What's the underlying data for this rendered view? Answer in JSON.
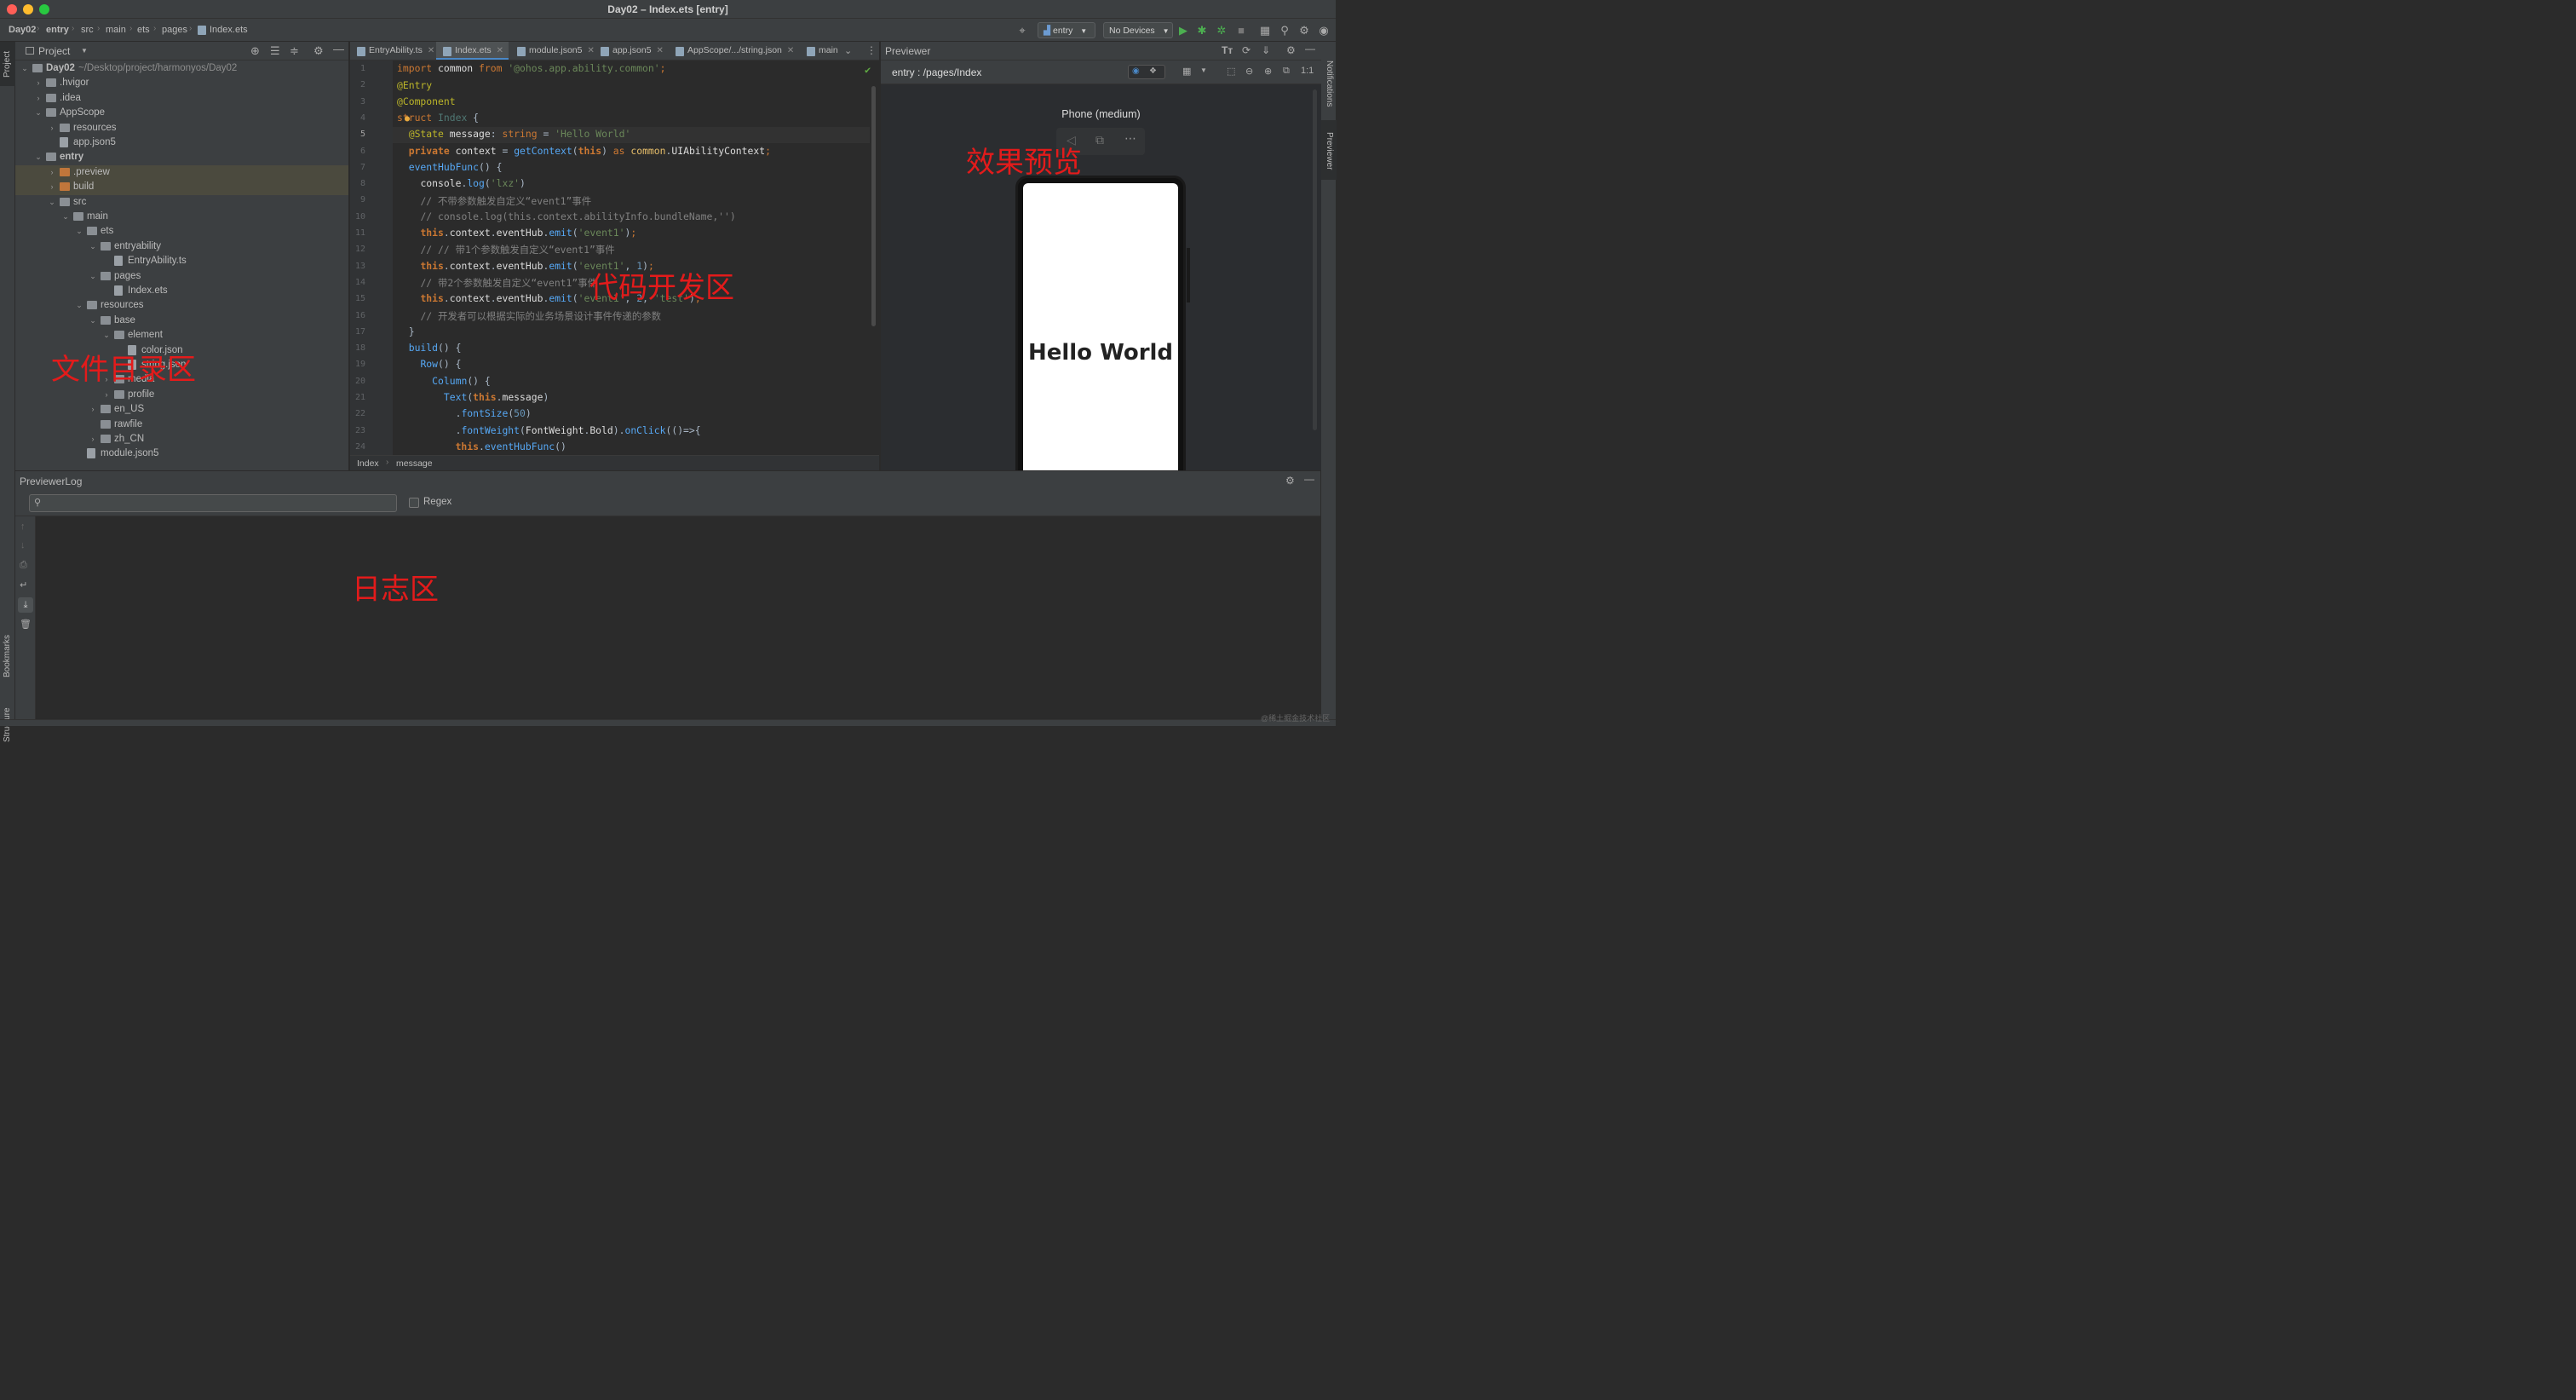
{
  "window": {
    "title": "Day02 – Index.ets [entry]",
    "traffic_colors": [
      "#ff5f57",
      "#febc2e",
      "#28c840"
    ]
  },
  "navbar": {
    "breadcrumb": [
      "Day02",
      "entry",
      "src",
      "main",
      "ets",
      "pages",
      "Index.ets"
    ],
    "module_select": "entry",
    "device_select": "No Devices"
  },
  "left_strip": {
    "project": "Project",
    "bookmarks": "Bookmarks",
    "structure": "Structure"
  },
  "right_strip": {
    "notifications": "Notifications",
    "previewer": "Previewer"
  },
  "project_panel": {
    "title": "Project",
    "tree": [
      {
        "label": "Day02",
        "suffix": "~/Desktop/project/harmonyos/Day02",
        "depth": 0,
        "arrow": "open",
        "type": "folder",
        "bold": true
      },
      {
        "label": ".hvigor",
        "depth": 1,
        "arrow": "closed",
        "type": "folder"
      },
      {
        "label": ".idea",
        "depth": 1,
        "arrow": "closed",
        "type": "folder"
      },
      {
        "label": "AppScope",
        "depth": 1,
        "arrow": "open",
        "type": "folder"
      },
      {
        "label": "resources",
        "depth": 2,
        "arrow": "closed",
        "type": "folder"
      },
      {
        "label": "app.json5",
        "depth": 2,
        "arrow": "none",
        "type": "file"
      },
      {
        "label": "entry",
        "depth": 1,
        "arrow": "open",
        "type": "folder",
        "bold": true
      },
      {
        "label": ".preview",
        "depth": 2,
        "arrow": "closed",
        "type": "folder-orange",
        "selected": true
      },
      {
        "label": "build",
        "depth": 2,
        "arrow": "closed",
        "type": "folder-orange",
        "selected": true
      },
      {
        "label": "src",
        "depth": 2,
        "arrow": "open",
        "type": "folder"
      },
      {
        "label": "main",
        "depth": 3,
        "arrow": "open",
        "type": "folder"
      },
      {
        "label": "ets",
        "depth": 4,
        "arrow": "open",
        "type": "folder"
      },
      {
        "label": "entryability",
        "depth": 5,
        "arrow": "open",
        "type": "folder"
      },
      {
        "label": "EntryAbility.ts",
        "depth": 6,
        "arrow": "none",
        "type": "file"
      },
      {
        "label": "pages",
        "depth": 5,
        "arrow": "open",
        "type": "folder"
      },
      {
        "label": "Index.ets",
        "depth": 6,
        "arrow": "none",
        "type": "file"
      },
      {
        "label": "resources",
        "depth": 4,
        "arrow": "open",
        "type": "folder"
      },
      {
        "label": "base",
        "depth": 5,
        "arrow": "open",
        "type": "folder"
      },
      {
        "label": "element",
        "depth": 6,
        "arrow": "open",
        "type": "folder"
      },
      {
        "label": "color.json",
        "depth": 7,
        "arrow": "none",
        "type": "file"
      },
      {
        "label": "string.json",
        "depth": 7,
        "arrow": "none",
        "type": "file"
      },
      {
        "label": "media",
        "depth": 6,
        "arrow": "closed",
        "type": "folder"
      },
      {
        "label": "profile",
        "depth": 6,
        "arrow": "closed",
        "type": "folder"
      },
      {
        "label": "en_US",
        "depth": 5,
        "arrow": "closed",
        "type": "folder"
      },
      {
        "label": "rawfile",
        "depth": 5,
        "arrow": "none",
        "type": "folder"
      },
      {
        "label": "zh_CN",
        "depth": 5,
        "arrow": "closed",
        "type": "folder"
      },
      {
        "label": "module.json5",
        "depth": 4,
        "arrow": "none",
        "type": "file"
      }
    ]
  },
  "editor": {
    "tabs": [
      {
        "label": "EntryAbility.ts",
        "active": false
      },
      {
        "label": "Index.ets",
        "active": true
      },
      {
        "label": "module.json5",
        "active": false
      },
      {
        "label": "app.json5",
        "active": false
      },
      {
        "label": "AppScope/.../string.json",
        "active": false
      },
      {
        "label": "main",
        "active": false
      }
    ],
    "line_numbers": [
      "1",
      "2",
      "3",
      "4",
      "5",
      "6",
      "7",
      "8",
      "9",
      "10",
      "11",
      "12",
      "13",
      "14",
      "15",
      "16",
      "17",
      "18",
      "19",
      "20",
      "21",
      "22",
      "23",
      "24"
    ],
    "current_line": 5,
    "breadcrumb": [
      "Index",
      "message"
    ]
  },
  "previewer": {
    "title": "Previewer",
    "route": "entry : /pages/Index",
    "device_label": "Phone (medium)",
    "screen_text": "Hello World"
  },
  "log": {
    "title": "PreviewerLog",
    "search_placeholder": "",
    "regex_label": "Regex"
  },
  "annotations": {
    "file_area": "文件目录区",
    "code_area": "代码开发区",
    "preview_area": "效果预览",
    "log_area": "日志区"
  },
  "watermark": "@稀土掘金技术社区"
}
